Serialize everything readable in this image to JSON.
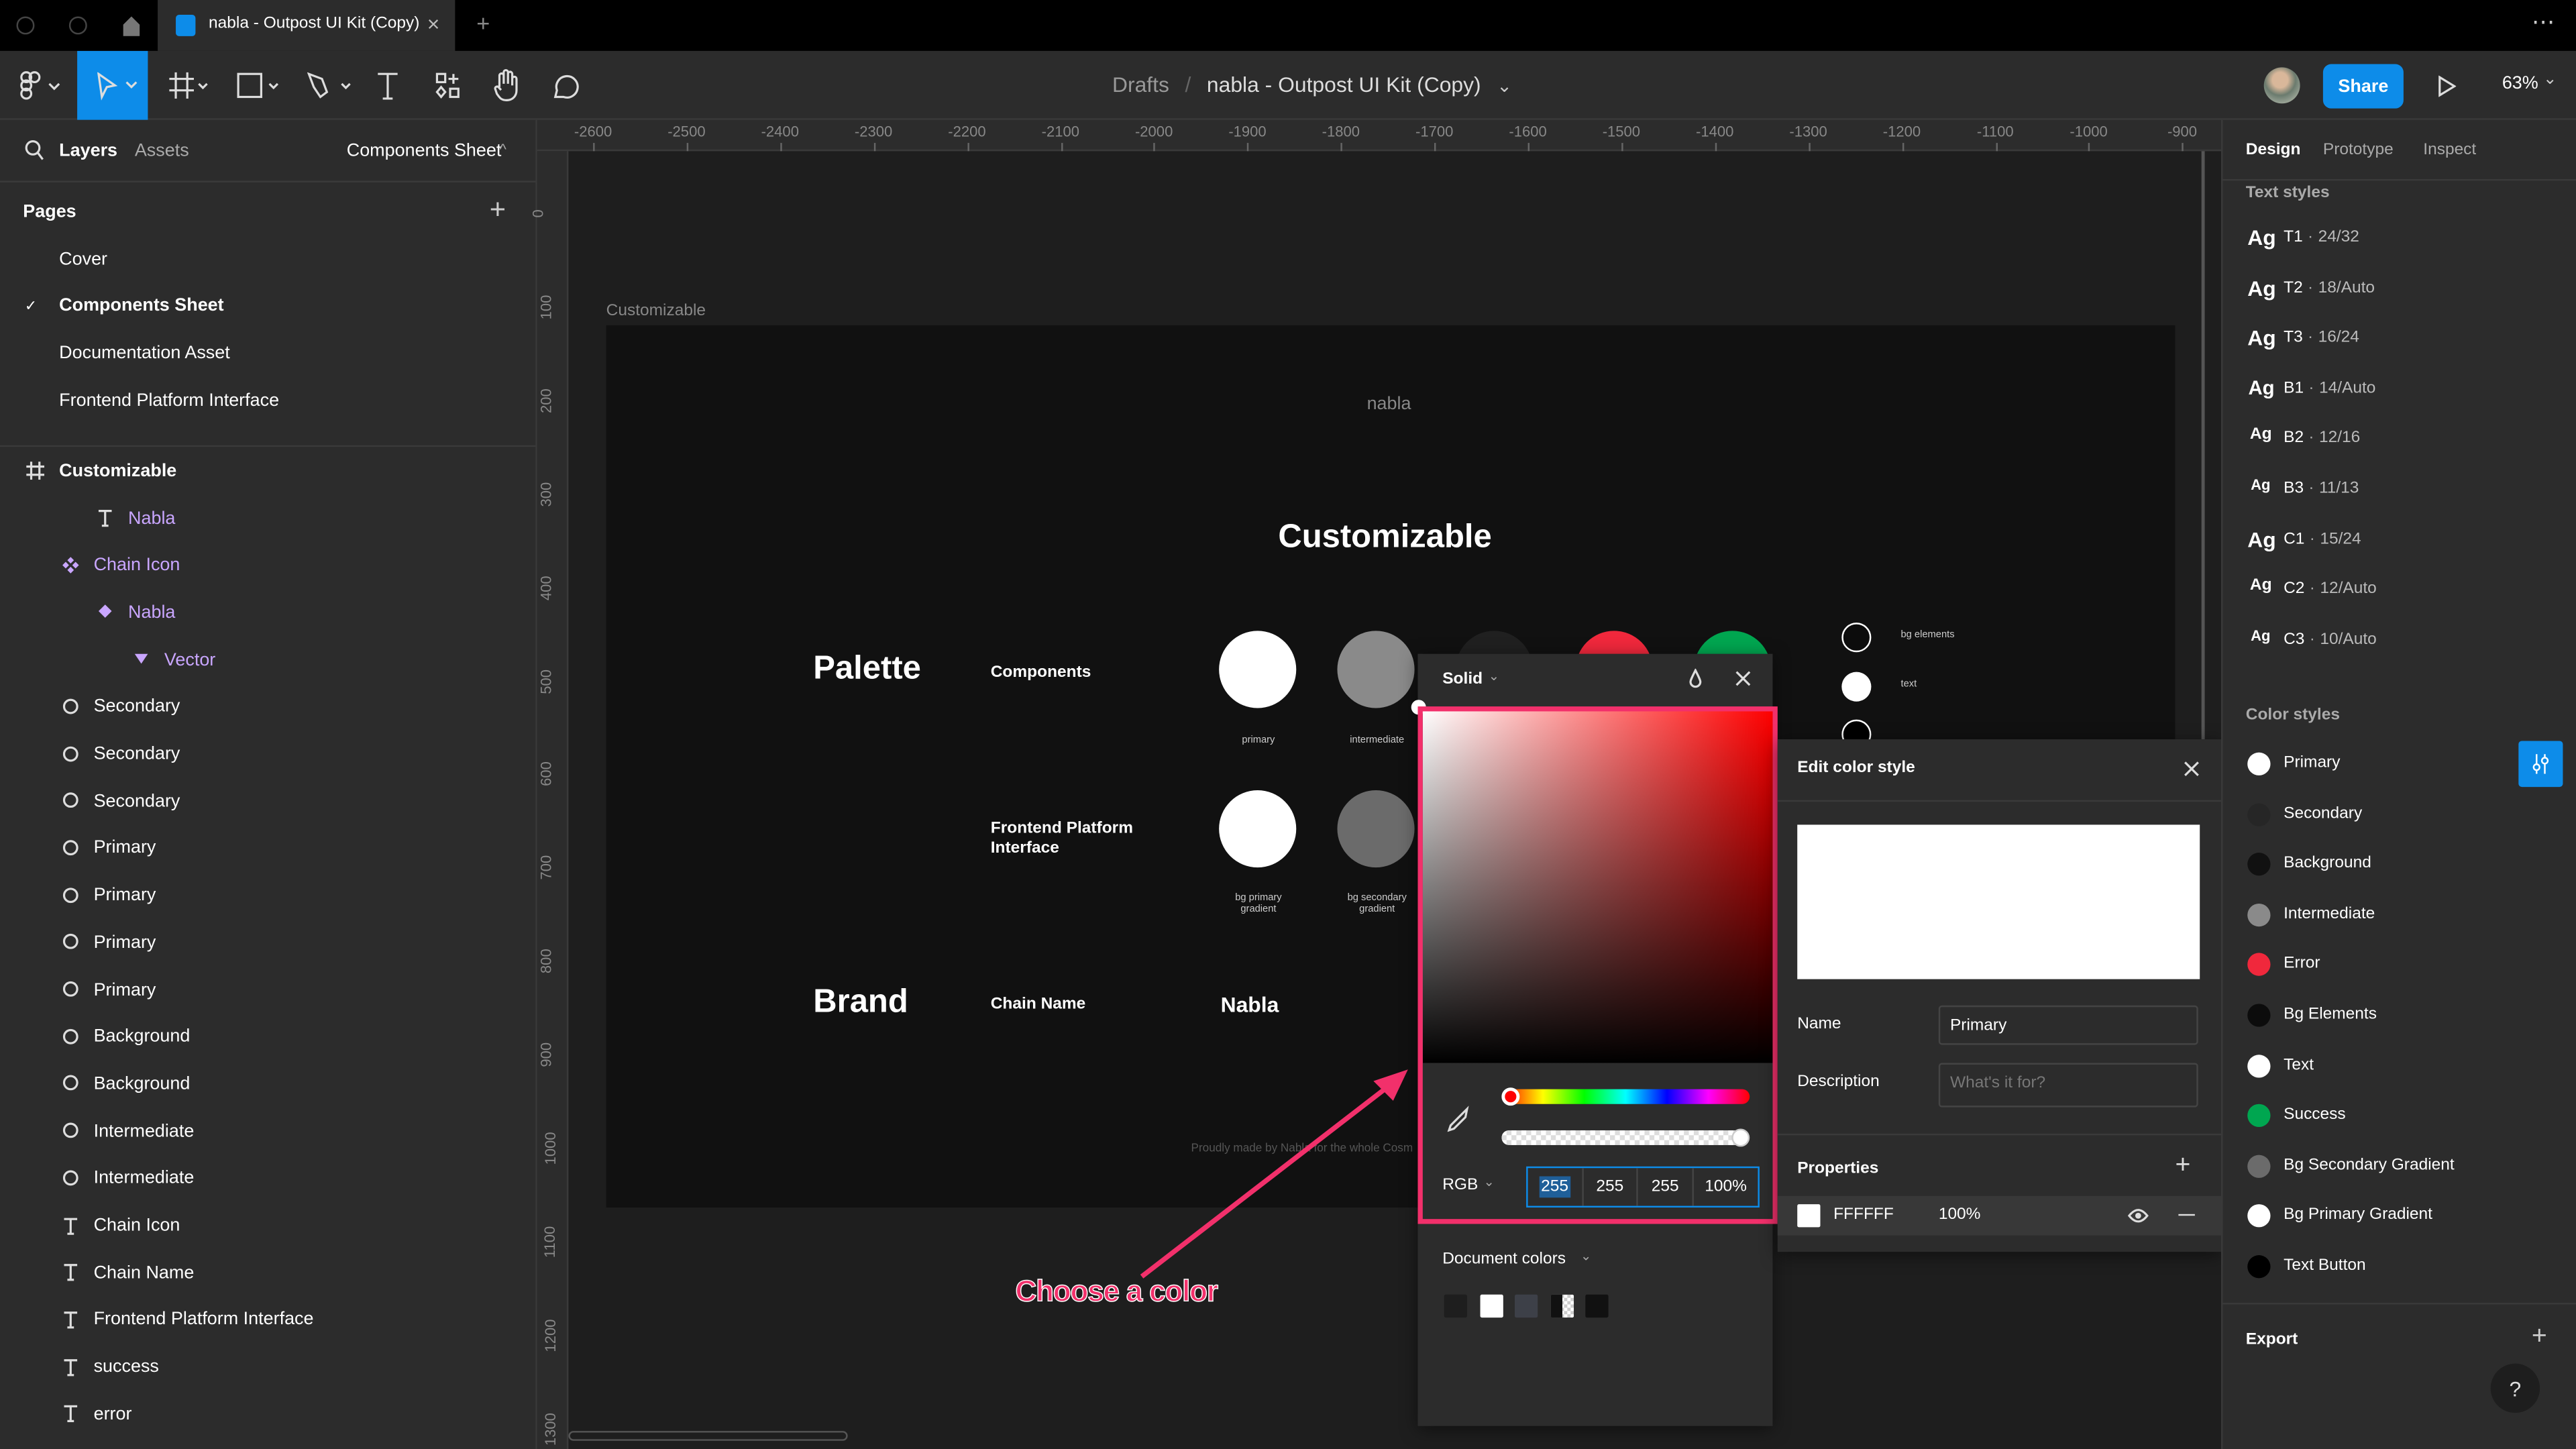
{
  "tabbar": {
    "tab_title": "nabla - Outpost UI Kit (Copy)",
    "close": "×",
    "new_tab": "+",
    "more": "⋯"
  },
  "toolbar": {
    "breadcrumb_root": "Drafts",
    "separator": "/",
    "file_name": "nabla - Outpost UI Kit (Copy)",
    "share": "Share",
    "zoom": "63%",
    "chevron": "⌄"
  },
  "left_panel": {
    "tabs": [
      "Layers",
      "Assets"
    ],
    "page_selector": "Components Sheet",
    "pages_title": "Pages",
    "add": "+",
    "check": "✓",
    "pages": [
      "Cover",
      "Components Sheet",
      "Documentation Asset",
      "Frontend Platform Interface"
    ],
    "current_page": 1,
    "frame": "Customizable",
    "layers": [
      {
        "label": "Nabla",
        "icon": "text",
        "indent": 2,
        "purple": true
      },
      {
        "label": "Chain Icon",
        "icon": "component",
        "indent": 1,
        "purple": true
      },
      {
        "label": "Nabla",
        "icon": "instance",
        "indent": 2,
        "purple": true
      },
      {
        "label": "Vector",
        "icon": "vector",
        "indent": 3,
        "purple": true
      },
      {
        "label": "Secondary",
        "icon": "ellipse",
        "indent": 1
      },
      {
        "label": "Secondary",
        "icon": "ellipse",
        "indent": 1
      },
      {
        "label": "Secondary",
        "icon": "ellipse",
        "indent": 1
      },
      {
        "label": "Primary",
        "icon": "ellipse",
        "indent": 1
      },
      {
        "label": "Primary",
        "icon": "ellipse",
        "indent": 1
      },
      {
        "label": "Primary",
        "icon": "ellipse",
        "indent": 1
      },
      {
        "label": "Primary",
        "icon": "ellipse",
        "indent": 1
      },
      {
        "label": "Background",
        "icon": "ellipse",
        "indent": 1
      },
      {
        "label": "Background",
        "icon": "ellipse",
        "indent": 1
      },
      {
        "label": "Intermediate",
        "icon": "ellipse",
        "indent": 1
      },
      {
        "label": "Intermediate",
        "icon": "ellipse",
        "indent": 1
      },
      {
        "label": "Chain Icon",
        "icon": "text",
        "indent": 1
      },
      {
        "label": "Chain Name",
        "icon": "text",
        "indent": 1
      },
      {
        "label": "Frontend Platform Interface",
        "icon": "text",
        "indent": 1
      },
      {
        "label": "success",
        "icon": "text",
        "indent": 1
      },
      {
        "label": "error",
        "icon": "text",
        "indent": 1
      }
    ]
  },
  "rulers": {
    "top": [
      "-2600",
      "-2500",
      "-2400",
      "-2300",
      "-2200",
      "-2100",
      "-2000",
      "-1900",
      "-1800",
      "-1700",
      "-1600",
      "-1500",
      "-1400",
      "-1300",
      "-1200",
      "-1100",
      "-1000",
      "-900"
    ],
    "left": [
      "0",
      "100",
      "200",
      "300",
      "400",
      "500",
      "600",
      "700",
      "800",
      "900",
      "1000",
      "1100",
      "1200",
      "1300"
    ]
  },
  "canvas": {
    "frame_label": "Customizable",
    "logo": "nabla",
    "title": "Customizable",
    "palette": "Palette",
    "components": "Components",
    "frontend": "Frontend Platform Interface",
    "brand": "Brand",
    "chain_name": "Chain Name",
    "chain_value": "Nabla",
    "footer": "Proudly made by Nabla for the whole Cosm",
    "swatches_row1": [
      {
        "caption": "primary",
        "color": "#ffffff"
      },
      {
        "caption": "intermediate",
        "color": "#8a8a8a"
      },
      {
        "caption": "",
        "color": "#202020"
      },
      {
        "caption": "",
        "color": "#f0283c"
      },
      {
        "caption": "",
        "color": "#00a650"
      }
    ],
    "swatches_row2": [
      {
        "caption": "bg primary gradient",
        "color": "#ffffff"
      },
      {
        "caption": "bg secondary gradient",
        "color": "#6b6b6b"
      }
    ],
    "side_swatches": [
      {
        "caption": "bg elements",
        "color": "#0c0c0c",
        "outline": true
      },
      {
        "caption": "text",
        "color": "#ffffff",
        "outline": false
      },
      {
        "caption": "",
        "color": "#000000",
        "outline": true
      }
    ],
    "annotation": "Choose a color"
  },
  "color_picker": {
    "mode": "Solid",
    "format": "RGB",
    "r": "255",
    "g": "255",
    "b": "255",
    "a": "100%",
    "hue": "#ff0000",
    "doc_colors_title": "Document colors",
    "doc_colors": [
      "#1e1e1e",
      "#ffffff",
      "#3d4048",
      "checker",
      "#111111"
    ]
  },
  "edit_style": {
    "title": "Edit color style",
    "name_label": "Name",
    "name_value": "Primary",
    "desc_label": "Description",
    "desc_placeholder": "What's it for?",
    "properties": "Properties",
    "hex": "FFFFFF",
    "opacity": "100%",
    "preview": "#ffffff"
  },
  "right_panel": {
    "tabs": [
      "Design",
      "Prototype",
      "Inspect"
    ],
    "text_styles_title": "Text styles",
    "text_styles": [
      {
        "name": "T1",
        "spec": "24/32",
        "size": 13
      },
      {
        "name": "T2",
        "spec": "18/Auto",
        "size": 13
      },
      {
        "name": "T3",
        "spec": "16/24",
        "size": 13
      },
      {
        "name": "B1",
        "spec": "14/Auto",
        "size": 12
      },
      {
        "name": "B2",
        "spec": "12/16",
        "size": 10
      },
      {
        "name": "B3",
        "spec": "11/13",
        "size": 9
      },
      {
        "name": "C1",
        "spec": "15/24",
        "size": 13
      },
      {
        "name": "C2",
        "spec": "12/Auto",
        "size": 10
      },
      {
        "name": "C3",
        "spec": "10/Auto",
        "size": 9
      }
    ],
    "sample": "Ag",
    "dot": "·",
    "color_styles_title": "Color styles",
    "color_styles": [
      {
        "name": "Primary",
        "color": "#ffffff"
      },
      {
        "name": "Secondary",
        "color": "#262626"
      },
      {
        "name": "Background",
        "color": "#111111"
      },
      {
        "name": "Intermediate",
        "color": "#8a8a8a"
      },
      {
        "name": "Error",
        "color": "#f0283c"
      },
      {
        "name": "Bg Elements",
        "color": "#0c0c0c"
      },
      {
        "name": "Text",
        "color": "#ffffff"
      },
      {
        "name": "Success",
        "color": "#00a650"
      },
      {
        "name": "Bg Secondary Gradient",
        "color": "#6b6b6b"
      },
      {
        "name": "Bg Primary Gradient",
        "color": "#ffffff"
      },
      {
        "name": "Text Button",
        "color": "#000000"
      }
    ],
    "export": "Export",
    "help": "?"
  },
  "colors": {
    "accent": "#0d8ce9",
    "highlight": "#f2306b",
    "purple": "#c9a6ff"
  }
}
